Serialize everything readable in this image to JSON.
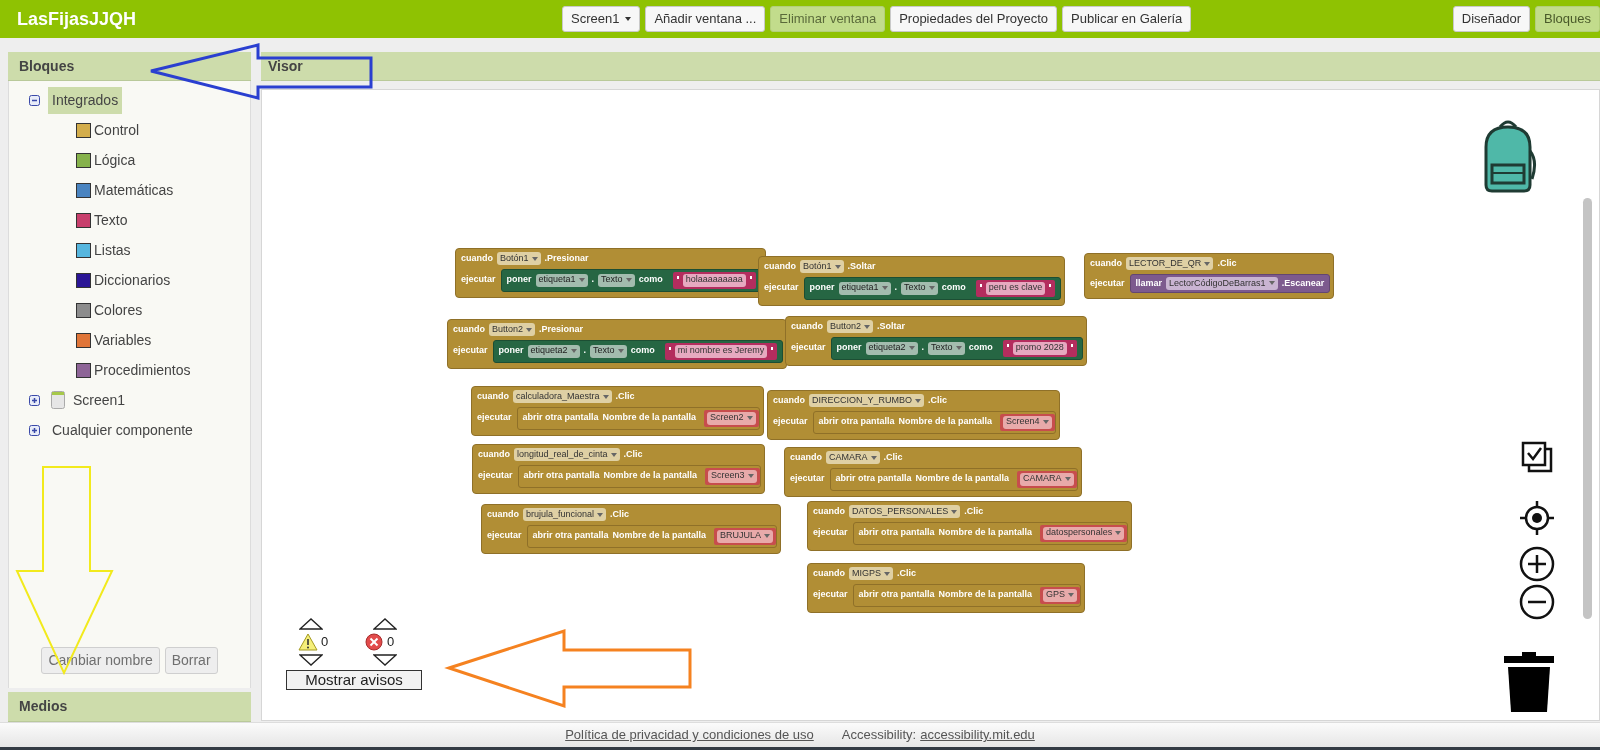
{
  "app_bar": {
    "title": "LasFijasJJQH",
    "actions": [
      {
        "label": "Screen1",
        "kind": "dropdown",
        "disabled": false
      },
      {
        "label": "Añadir ventana ...",
        "kind": "button",
        "disabled": false
      },
      {
        "label": "Eliminar ventana",
        "kind": "button",
        "disabled": true
      },
      {
        "label": "Propiedades del Proyecto",
        "kind": "button",
        "disabled": false
      },
      {
        "label": "Publicar en Galería",
        "kind": "button",
        "disabled": false
      }
    ],
    "views": [
      {
        "label": "Diseñador",
        "selected": false
      },
      {
        "label": "Bloques",
        "selected": true
      }
    ]
  },
  "blocks_panel": {
    "title": "Bloques",
    "tree": [
      {
        "label": "Integrados",
        "kind": "category",
        "expanded": true,
        "selected": true,
        "children": [
          {
            "label": "Control",
            "color": "#d3ad4b"
          },
          {
            "label": "Lógica",
            "color": "#86b24b"
          },
          {
            "label": "Matemáticas",
            "color": "#4a84c0"
          },
          {
            "label": "Texto",
            "color": "#c83f6c"
          },
          {
            "label": "Listas",
            "color": "#56b6de"
          },
          {
            "label": "Diccionarios",
            "color": "#2b1696"
          },
          {
            "label": "Colores",
            "color": "#8c8c8c"
          },
          {
            "label": "Variables",
            "color": "#e07538"
          },
          {
            "label": "Procedimientos",
            "color": "#8e6597"
          }
        ]
      },
      {
        "label": "Screen1",
        "kind": "component",
        "expanded": false,
        "selected": false
      },
      {
        "label": "Cualquier componente",
        "kind": "category",
        "expanded": false,
        "selected": false
      }
    ],
    "buttons": [
      {
        "label": "Cambiar nombre",
        "disabled": true
      },
      {
        "label": "Borrar",
        "disabled": true
      }
    ]
  },
  "media_panel": {
    "title": "Medios"
  },
  "viewer": {
    "title": "Visor",
    "blocks": [
      {
        "when": "cuando",
        "component": "Botón1",
        "event": ".Presionar",
        "do": "ejecutar",
        "action": {
          "kind": "set",
          "verb": "poner",
          "component": "etiqueta1",
          "dot": ".",
          "property": "Texto",
          "as": "como",
          "value": "holaaaaaaaaa"
        }
      },
      {
        "when": "cuando",
        "component": "Botón1",
        "event": ".Soltar",
        "do": "ejecutar",
        "action": {
          "kind": "set",
          "verb": "poner",
          "component": "etiqueta1",
          "dot": ".",
          "property": "Texto",
          "as": "como",
          "value": "peru es clave"
        }
      },
      {
        "when": "cuando",
        "component": "LECTOR_DE_QR",
        "event": ".Clic",
        "do": "ejecutar",
        "action": {
          "kind": "call",
          "verb": "llamar",
          "component": "LectorCódigoDeBarras1",
          "method": ".Escanear"
        }
      },
      {
        "when": "cuando",
        "component": "Button2",
        "event": ".Presionar",
        "do": "ejecutar",
        "action": {
          "kind": "set",
          "verb": "poner",
          "component": "etiqueta2",
          "dot": ".",
          "property": "Texto",
          "as": "como",
          "value": "mi nombre es Jeremy"
        }
      },
      {
        "when": "cuando",
        "component": "Button2",
        "event": ".Soltar",
        "do": "ejecutar",
        "action": {
          "kind": "set",
          "verb": "poner",
          "component": "etiqueta2",
          "dot": ".",
          "property": "Texto",
          "as": "como",
          "value": "promo 2028"
        }
      },
      {
        "when": "cuando",
        "component": "calculadora_Maestra",
        "event": ".Clic",
        "do": "ejecutar",
        "action": {
          "kind": "open_screen",
          "verb": "abrir otra pantalla",
          "param": "Nombre de la pantalla",
          "value": "Screen2"
        }
      },
      {
        "when": "cuando",
        "component": "DIRECCION_Y_RUMBO",
        "event": ".Clic",
        "do": "ejecutar",
        "action": {
          "kind": "open_screen",
          "verb": "abrir otra pantalla",
          "param": "Nombre de la pantalla",
          "value": "Screen4"
        }
      },
      {
        "when": "cuando",
        "component": "longitud_real_de_cinta",
        "event": ".Clic",
        "do": "ejecutar",
        "action": {
          "kind": "open_screen",
          "verb": "abrir otra pantalla",
          "param": "Nombre de la pantalla",
          "value": "Screen3"
        }
      },
      {
        "when": "cuando",
        "component": "CAMARA",
        "event": ".Clic",
        "do": "ejecutar",
        "action": {
          "kind": "open_screen",
          "verb": "abrir otra pantalla",
          "param": "Nombre de la pantalla",
          "value": "CAMARA"
        }
      },
      {
        "when": "cuando",
        "component": "brujula_funcional",
        "event": ".Clic",
        "do": "ejecutar",
        "action": {
          "kind": "open_screen",
          "verb": "abrir otra pantalla",
          "param": "Nombre de la pantalla",
          "value": "BRUJULA"
        }
      },
      {
        "when": "cuando",
        "component": "DATOS_PERSONALES",
        "event": ".Clic",
        "do": "ejecutar",
        "action": {
          "kind": "open_screen",
          "verb": "abrir otra pantalla",
          "param": "Nombre de la pantalla",
          "value": "datospersonales"
        }
      },
      {
        "when": "cuando",
        "component": "MIGPS",
        "event": ".Clic",
        "do": "ejecutar",
        "action": {
          "kind": "open_screen",
          "verb": "abrir otra pantalla",
          "param": "Nombre de la pantalla",
          "value": "GPS"
        }
      }
    ],
    "warnings": {
      "warning_count": "0",
      "error_count": "0",
      "button": "Mostrar avisos"
    }
  },
  "footer": {
    "privacy_link": "Política de privacidad y condiciones de uso",
    "accessibility_label": "Accessibility:",
    "accessibility_link": "accessibility.mit.edu"
  }
}
